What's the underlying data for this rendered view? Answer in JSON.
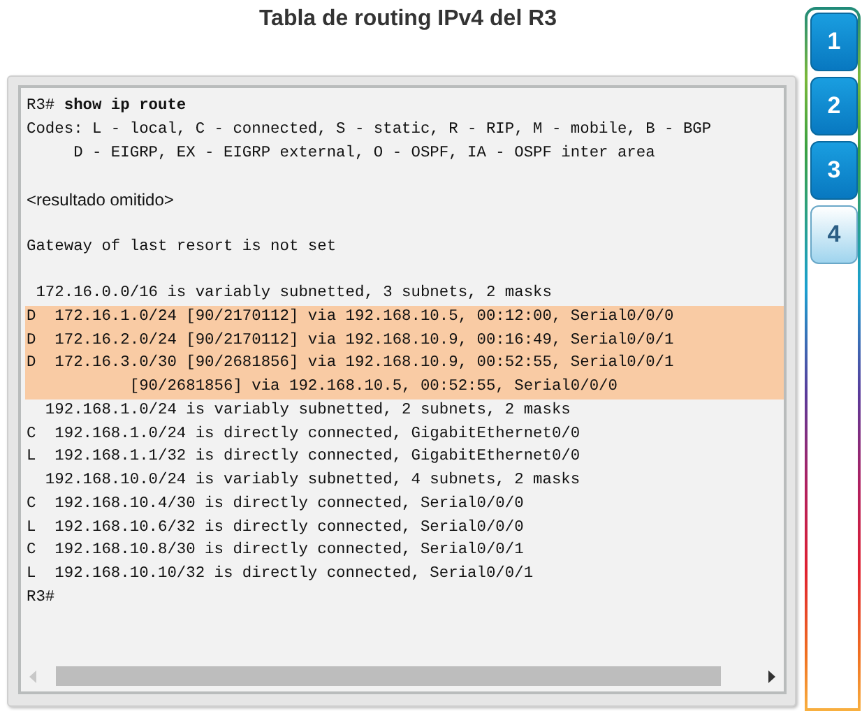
{
  "title": "Tabla de routing IPv4 del R3",
  "terminal": {
    "lines": [
      {
        "kind": "command",
        "text": "R3# **show ip route**",
        "highlighted": false
      },
      {
        "kind": "mono",
        "text": "Codes: L - local, C - connected, S - static, R - RIP, M - mobile, B - BGP",
        "highlighted": false
      },
      {
        "kind": "mono",
        "text": "     D - EIGRP, EX - EIGRP external, O - OSPF, IA - OSPF inter area",
        "highlighted": false
      },
      {
        "kind": "blank"
      },
      {
        "kind": "note",
        "text": "<resultado omitido>",
        "highlighted": false
      },
      {
        "kind": "blank"
      },
      {
        "kind": "mono",
        "text": "Gateway of last resort is not set",
        "highlighted": false
      },
      {
        "kind": "blank"
      },
      {
        "kind": "mono",
        "text": " 172.16.0.0/16 is variably subnetted, 3 subnets, 2 masks",
        "highlighted": false
      },
      {
        "kind": "mono",
        "text": "D  172.16.1.0/24 [90/2170112] via 192.168.10.5, 00:12:00, Serial0/0/0",
        "highlighted": true
      },
      {
        "kind": "mono",
        "text": "D  172.16.2.0/24 [90/2170112] via 192.168.10.9, 00:16:49, Serial0/0/1",
        "highlighted": true
      },
      {
        "kind": "mono",
        "text": "D  172.16.3.0/30 [90/2681856] via 192.168.10.9, 00:52:55, Serial0/0/1",
        "highlighted": true
      },
      {
        "kind": "mono",
        "text": "           [90/2681856] via 192.168.10.5, 00:52:55, Serial0/0/0",
        "highlighted": true
      },
      {
        "kind": "mono",
        "text": "  192.168.1.0/24 is variably subnetted, 2 subnets, 2 masks",
        "highlighted": false
      },
      {
        "kind": "mono",
        "text": "C  192.168.1.0/24 is directly connected, GigabitEthernet0/0",
        "highlighted": false
      },
      {
        "kind": "mono",
        "text": "L  192.168.1.1/32 is directly connected, GigabitEthernet0/0",
        "highlighted": false
      },
      {
        "kind": "mono",
        "text": "  192.168.10.0/24 is variably subnetted, 4 subnets, 2 masks",
        "highlighted": false
      },
      {
        "kind": "mono",
        "text": "C  192.168.10.4/30 is directly connected, Serial0/0/0",
        "highlighted": false
      },
      {
        "kind": "mono",
        "text": "L  192.168.10.6/32 is directly connected, Serial0/0/0",
        "highlighted": false
      },
      {
        "kind": "mono",
        "text": "C  192.168.10.8/30 is directly connected, Serial0/0/1",
        "highlighted": false
      },
      {
        "kind": "mono",
        "text": "L  192.168.10.10/32 is directly connected, Serial0/0/1",
        "highlighted": false
      },
      {
        "kind": "mono",
        "text": "R3#",
        "highlighted": false
      }
    ]
  },
  "tabs": [
    {
      "label": "1",
      "selected": false
    },
    {
      "label": "2",
      "selected": false
    },
    {
      "label": "3",
      "selected": false
    },
    {
      "label": "4",
      "selected": true
    }
  ]
}
